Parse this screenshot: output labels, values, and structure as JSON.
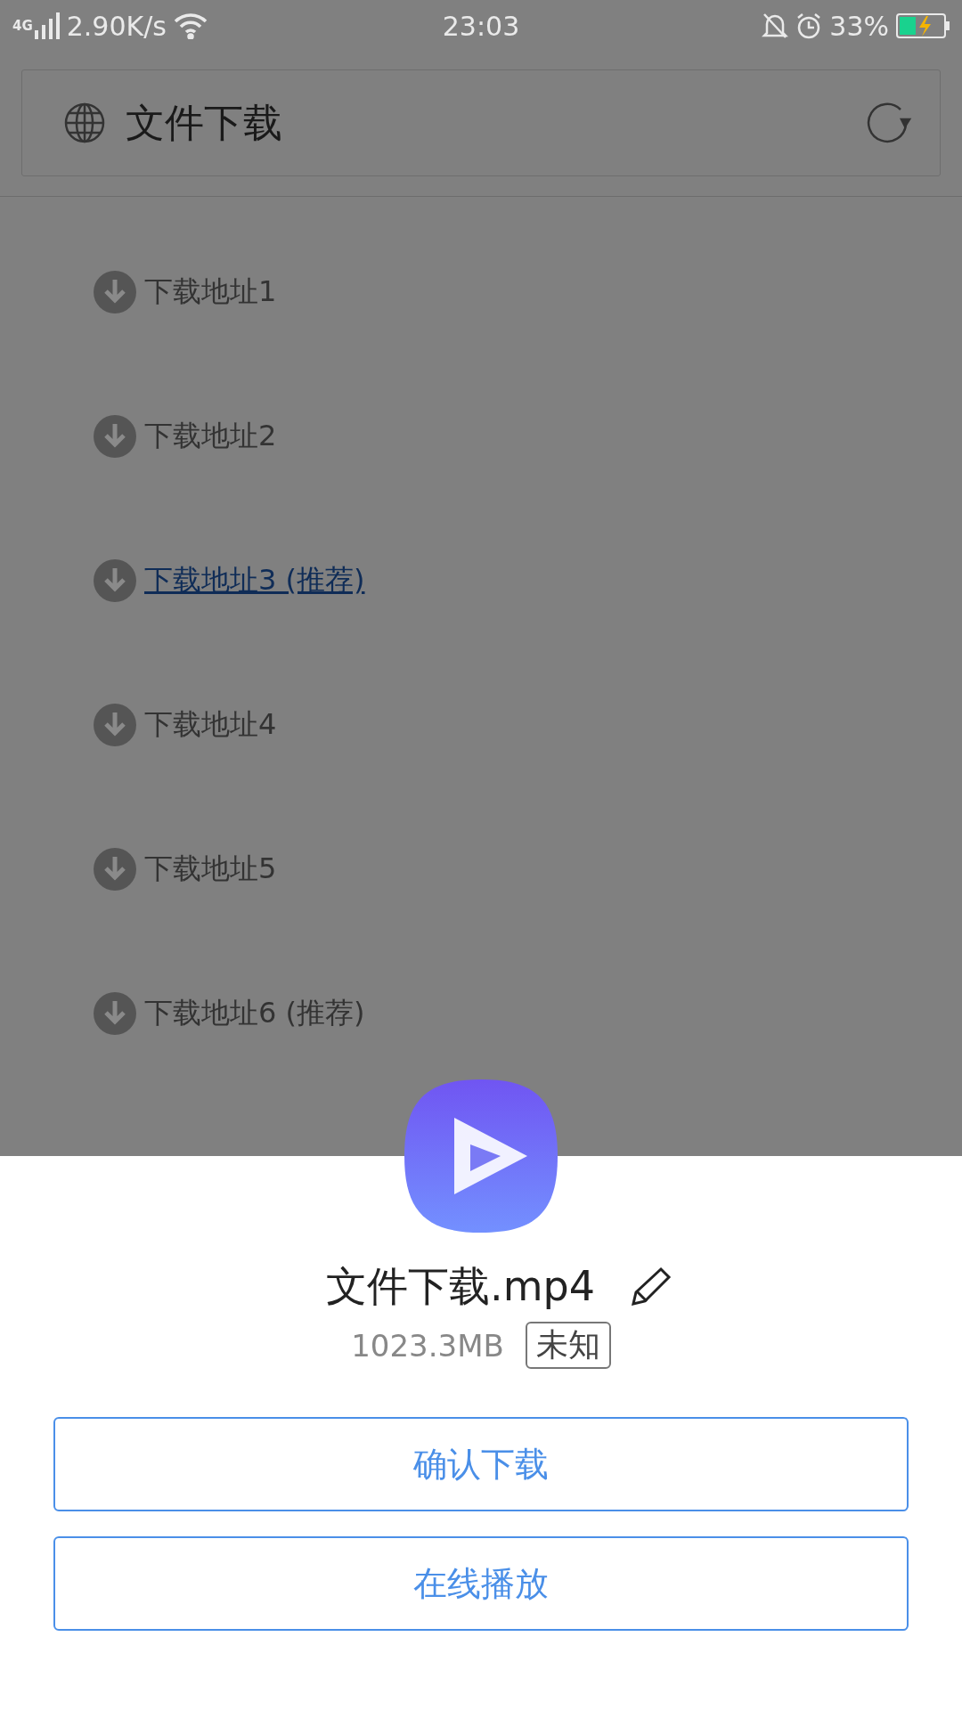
{
  "status_bar": {
    "network": "4G",
    "speed": "2.90K/s",
    "time": "23:03",
    "battery": "33%"
  },
  "header": {
    "title": "文件下载"
  },
  "links": [
    {
      "label": "下载地址1",
      "selected": false
    },
    {
      "label": "下载地址2",
      "selected": false
    },
    {
      "label": "下载地址3 (推荐)",
      "selected": true
    },
    {
      "label": "下载地址4",
      "selected": false
    },
    {
      "label": "下载地址5",
      "selected": false
    },
    {
      "label": "下载地址6 (推荐)",
      "selected": false
    }
  ],
  "sheet": {
    "file_name": "文件下载.mp4",
    "size": "1023.3MB",
    "tag": "未知",
    "buttons": [
      "确认下载",
      "在线播放"
    ]
  }
}
